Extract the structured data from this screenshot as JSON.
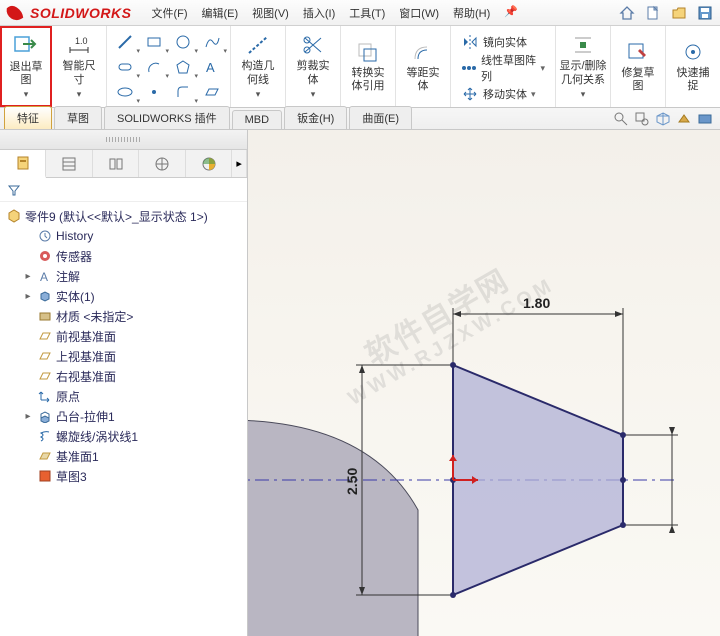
{
  "logo_text": "SOLIDWORKS",
  "menus": [
    {
      "label": "文件(F)"
    },
    {
      "label": "编辑(E)"
    },
    {
      "label": "视图(V)"
    },
    {
      "label": "插入(I)"
    },
    {
      "label": "工具(T)"
    },
    {
      "label": "窗口(W)"
    },
    {
      "label": "帮助(H)"
    }
  ],
  "ribbon": {
    "exit_sketch": "退出草\n图",
    "smart_dim": "智能尺\n寸",
    "construction_line": "构造几\n何线",
    "trim_entities": "剪裁实\n体",
    "convert_entities": "转换实\n体引用",
    "offset_entities": "等距实\n体",
    "mirror_entities": "镜向实体",
    "linear_pattern": "线性草图阵列",
    "move_entities": "移动实体",
    "show_relations": "显示/删除\n几何关系",
    "repair_sketch": "修复草\n图",
    "quick_snap": "快速捕\n捉"
  },
  "tabs": [
    {
      "label": "特征",
      "active": true
    },
    {
      "label": "草图"
    },
    {
      "label": "SOLIDWORKS 插件"
    },
    {
      "label": "MBD"
    },
    {
      "label": "钣金(H)"
    },
    {
      "label": "曲面(E)"
    }
  ],
  "tree": {
    "root": "零件9  (默认<<默认>_显示状态 1>)",
    "items": [
      {
        "icon": "history",
        "label": "History"
      },
      {
        "icon": "sensor",
        "label": "传感器"
      },
      {
        "icon": "annot",
        "label": "注解",
        "expander": true
      },
      {
        "icon": "solid",
        "label": "实体(1)",
        "expander": true
      },
      {
        "icon": "material",
        "label": "材质 <未指定>"
      },
      {
        "icon": "plane",
        "label": "前视基准面"
      },
      {
        "icon": "plane",
        "label": "上视基准面"
      },
      {
        "icon": "plane",
        "label": "右视基准面"
      },
      {
        "icon": "origin",
        "label": "原点"
      },
      {
        "icon": "feature",
        "label": "凸台-拉伸1",
        "expander": true
      },
      {
        "icon": "helix",
        "label": "螺旋线/涡状线1"
      },
      {
        "icon": "plane2",
        "label": "基准面1"
      },
      {
        "icon": "sketch",
        "label": "草图3"
      }
    ]
  },
  "dims": {
    "width": "1.80",
    "height": "2.50"
  },
  "watermark": {
    "line1": "软件自学网",
    "line2": "WWW.RJZXW.COM"
  }
}
